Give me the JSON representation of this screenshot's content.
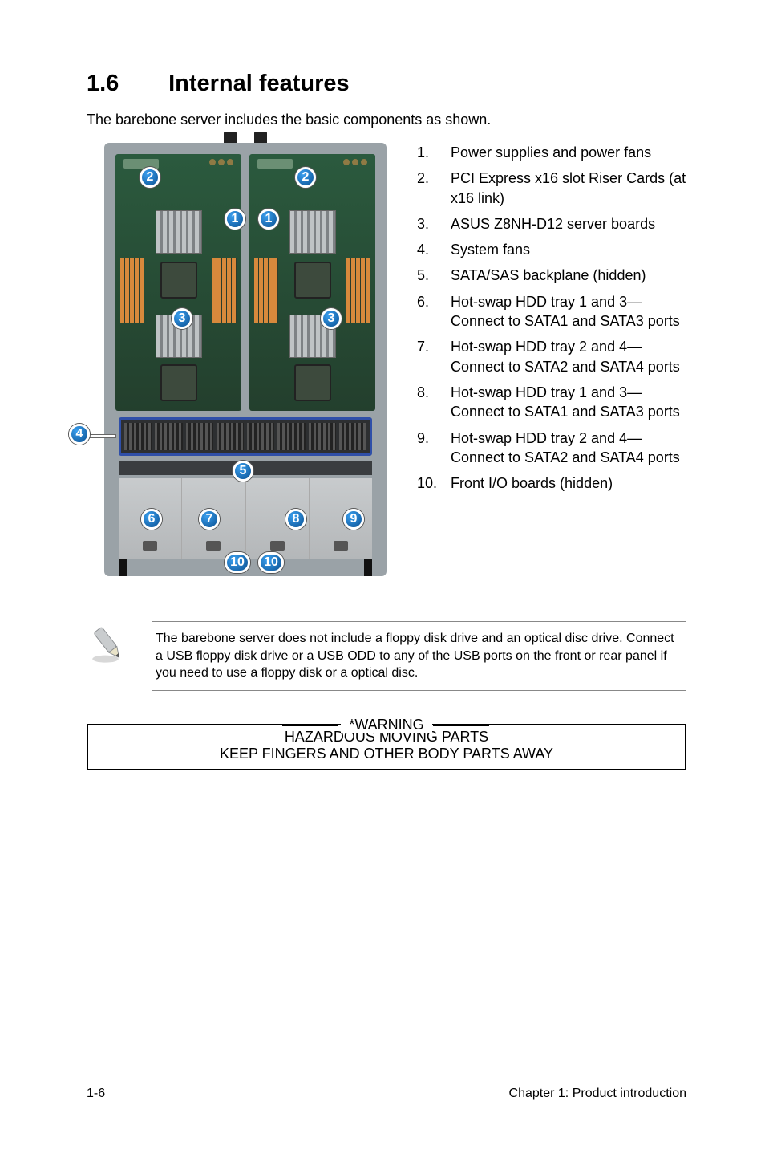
{
  "heading": {
    "number": "1.6",
    "title": "Internal features"
  },
  "intro": "The barebone server includes the basic components as shown.",
  "feature_list": [
    {
      "n": "1.",
      "t": "Power supplies and power fans"
    },
    {
      "n": "2.",
      "t": "PCI Express x16 slot Riser Cards (at x16 link)"
    },
    {
      "n": "3.",
      "t": "ASUS Z8NH-D12 server boards"
    },
    {
      "n": "4.",
      "t": "System fans"
    },
    {
      "n": "5.",
      "t": "SATA/SAS backplane (hidden)"
    },
    {
      "n": "6.",
      "t": "Hot-swap HDD tray 1 and 3—Connect to SATA1 and SATA3 ports"
    },
    {
      "n": "7.",
      "t": "Hot-swap HDD tray 2 and 4—Connect to SATA2 and SATA4 ports"
    },
    {
      "n": "8.",
      "t": "Hot-swap HDD tray 1 and 3—Connect to SATA1 and SATA3 ports"
    },
    {
      "n": "9.",
      "t": "Hot-swap HDD tray 2 and 4—Connect to SATA2 and SATA4 ports"
    },
    {
      "n": "10.",
      "t": "Front I/O boards (hidden)"
    }
  ],
  "note": "The barebone server does not include a floppy disk drive and an optical disc drive. Connect a USB floppy disk drive or a USB ODD to any of the USB ports on the front or rear panel if you need to use a floppy disk or a optical disc.",
  "warning": {
    "title": "*WARNING",
    "line1": "HAZARDOUS MOVING PARTS",
    "line2": "KEEP FINGERS AND OTHER BODY PARTS AWAY"
  },
  "callouts": {
    "c1": "1",
    "c2": "2",
    "c3": "3",
    "c4": "4",
    "c5": "5",
    "c6": "6",
    "c7": "7",
    "c8": "8",
    "c9": "9",
    "c10": "10"
  },
  "footer": {
    "left": "1-6",
    "right": "Chapter 1:  Product introduction"
  }
}
